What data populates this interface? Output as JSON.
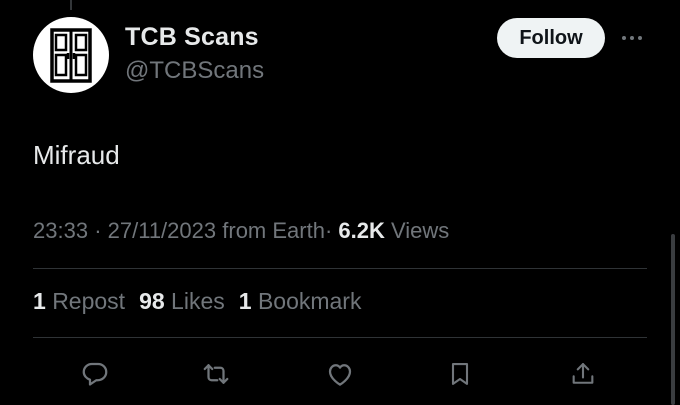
{
  "tweet": {
    "author": {
      "display_name": "TCB Scans",
      "handle": "@TCBScans",
      "avatar_icon": "door-logo-icon"
    },
    "follow_label": "Follow",
    "more_icon": "more-horizontal-icon",
    "text": "Mifraud",
    "meta": {
      "time": "23:33",
      "separator": "·",
      "date": "27/11/2023",
      "source": "from Earth",
      "views_count": "6.2K",
      "views_label": "Views"
    },
    "stats": {
      "reposts_count": "1",
      "reposts_label": "Repost",
      "likes_count": "98",
      "likes_label": "Likes",
      "bookmarks_count": "1",
      "bookmarks_label": "Bookmark"
    },
    "actions": [
      {
        "icon": "reply-icon"
      },
      {
        "icon": "repost-icon"
      },
      {
        "icon": "like-icon"
      },
      {
        "icon": "bookmark-icon"
      },
      {
        "icon": "share-icon"
      }
    ]
  },
  "colors": {
    "background": "#000000",
    "primary_text": "#e7e9ea",
    "secondary_text": "#71767b",
    "divider": "#2f3336",
    "follow_button_bg": "#eff3f4",
    "follow_button_text": "#0f1419"
  }
}
